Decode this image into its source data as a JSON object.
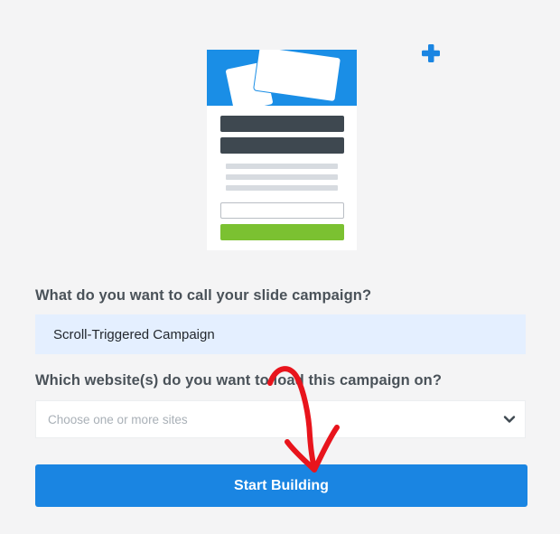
{
  "form": {
    "campaign_name_label": "What do you want to call your slide campaign?",
    "campaign_name_value": "Scroll-Triggered Campaign",
    "websites_label": "Which website(s) do you want to load this campaign on?",
    "websites_placeholder": "Choose one or more sites",
    "submit_label": "Start Building"
  },
  "icons": {
    "add": "plus-icon",
    "dropdown": "chevron-down-icon",
    "annotation": "red-arrow-icon"
  },
  "colors": {
    "page_background": "#f4f4f5",
    "accent": "#1a85e2",
    "input_fill": "#e4efff",
    "annotation": "#e8141c",
    "submit_green": "#7bc131"
  }
}
